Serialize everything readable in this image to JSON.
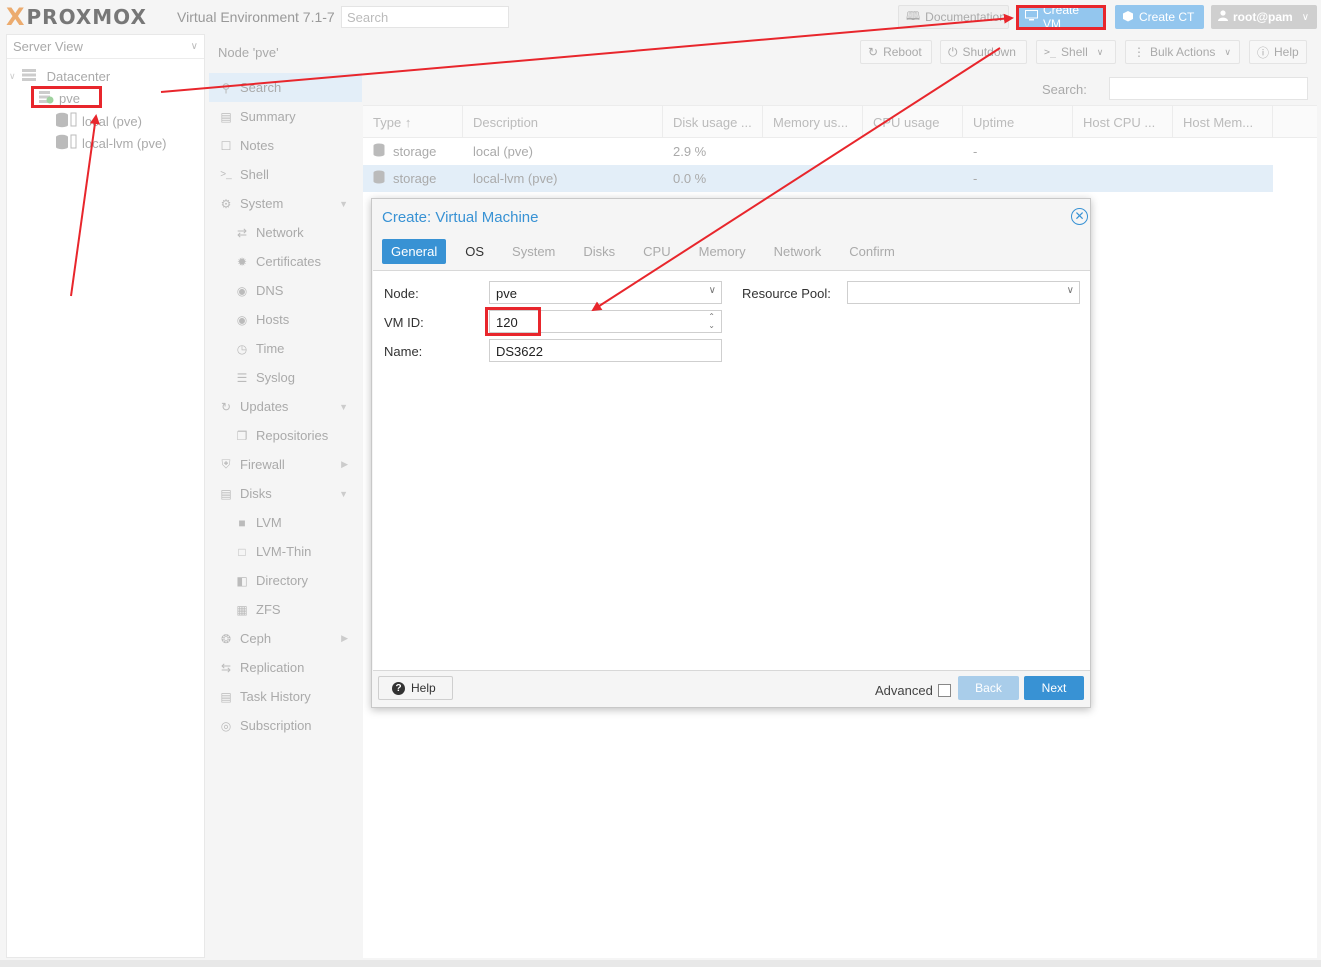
{
  "topbar": {
    "logo_x": "X",
    "logo_text": "PROXMOX",
    "version": "Virtual Environment 7.1-7",
    "search_placeholder": "Search",
    "documentation": "Documentation",
    "create_vm": "Create VM",
    "create_ct": "Create CT",
    "user": "root@pam"
  },
  "tree": {
    "view": "Server View",
    "datacenter": "Datacenter",
    "node": "pve",
    "storages": [
      "local (pve)",
      "local-lvm (pve)"
    ]
  },
  "node_header": {
    "title": "Node 'pve'",
    "reboot": "Reboot",
    "shutdown": "Shutdown",
    "shell": "Shell",
    "bulk_actions": "Bulk Actions",
    "help": "Help"
  },
  "menu": {
    "search": "Search",
    "summary": "Summary",
    "notes": "Notes",
    "shell": "Shell",
    "system": "System",
    "network": "Network",
    "certificates": "Certificates",
    "dns": "DNS",
    "hosts": "Hosts",
    "time": "Time",
    "syslog": "Syslog",
    "updates": "Updates",
    "repositories": "Repositories",
    "firewall": "Firewall",
    "disks": "Disks",
    "lvm": "LVM",
    "lvm_thin": "LVM-Thin",
    "directory": "Directory",
    "zfs": "ZFS",
    "ceph": "Ceph",
    "replication": "Replication",
    "task_history": "Task History",
    "subscription": "Subscription"
  },
  "content": {
    "search_label": "Search:",
    "columns": [
      "Type",
      "Description",
      "Disk usage ...",
      "Memory us...",
      "CPU usage",
      "Uptime",
      "Host CPU ...",
      "Host Mem..."
    ],
    "rows": [
      {
        "type": "storage",
        "description": "local (pve)",
        "disk": "2.9 %",
        "uptime": "-"
      },
      {
        "type": "storage",
        "description": "local-lvm (pve)",
        "disk": "0.0 %",
        "uptime": "-"
      }
    ]
  },
  "dialog": {
    "title": "Create: Virtual Machine",
    "tabs": [
      "General",
      "OS",
      "System",
      "Disks",
      "CPU",
      "Memory",
      "Network",
      "Confirm"
    ],
    "node_label": "Node:",
    "node_value": "pve",
    "vmid_label": "VM ID:",
    "vmid_value": "120",
    "name_label": "Name:",
    "name_value": "DS3622",
    "pool_label": "Resource Pool:",
    "pool_value": "",
    "help": "Help",
    "advanced": "Advanced",
    "back": "Back",
    "next": "Next"
  },
  "colors": {
    "accent": "#3892d4",
    "annotation_red": "#e8262c",
    "logo_orange": "#e57000"
  }
}
